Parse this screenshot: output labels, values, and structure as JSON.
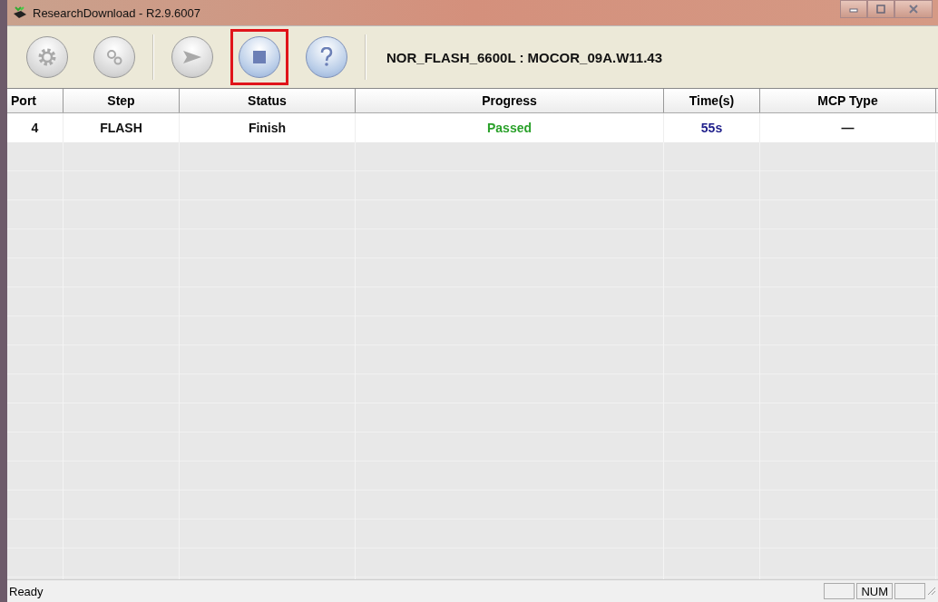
{
  "window": {
    "title": "ResearchDownload - R2.9.6007"
  },
  "toolbar": {
    "buttons": [
      {
        "kind": "settings",
        "disabled": true,
        "highlighted": false
      },
      {
        "kind": "load",
        "disabled": true,
        "highlighted": false
      },
      {
        "kind": "start",
        "disabled": true,
        "highlighted": false
      },
      {
        "kind": "stop",
        "disabled": false,
        "highlighted": true
      },
      {
        "kind": "help",
        "disabled": false,
        "highlighted": false
      }
    ],
    "product": "NOR_FLASH_6600L : MOCOR_09A.W11.43"
  },
  "table": {
    "columns": [
      "Port",
      "Step",
      "Status",
      "Progress",
      "Time(s)",
      "MCP Type"
    ],
    "rows": [
      {
        "cells": [
          "4",
          "FLASH",
          "Finish",
          "Passed",
          "55s",
          "—"
        ]
      }
    ]
  },
  "status_bar": {
    "text": "Ready",
    "indicator": "NUM"
  }
}
